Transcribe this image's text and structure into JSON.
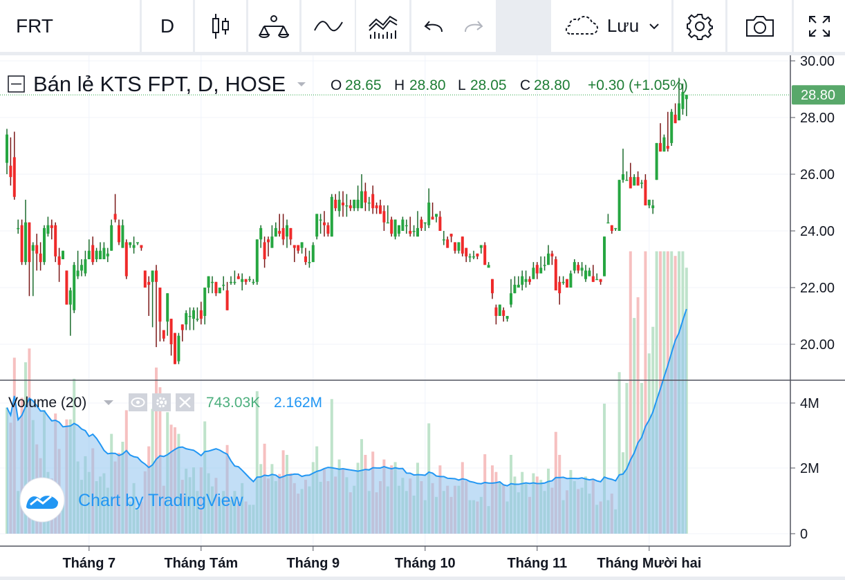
{
  "toolbar": {
    "symbol": "FRT",
    "interval": "D",
    "save_label": "Lưu",
    "icons": [
      "candles-icon",
      "indicators-icon",
      "compare-icon",
      "templates-icon",
      "undo-icon",
      "redo-icon",
      "cloud-icon",
      "chevron-down-icon",
      "gear-icon",
      "camera-icon",
      "fullscreen-icon"
    ]
  },
  "legend": {
    "title": "Bán lẻ KTS FPT, D, HOSE",
    "o_label": "O",
    "o_value": "28.65",
    "h_label": "H",
    "h_value": "28.80",
    "l_label": "L",
    "l_value": "28.05",
    "c_label": "C",
    "c_value": "28.80",
    "change": "+0.30 (+1.05%)",
    "last_price_tag": "28.80"
  },
  "volume_legend": {
    "title": "Volume (20)",
    "value": "743.03K",
    "ma_value": "2.162M"
  },
  "watermark": "Chart by TradingView",
  "colors": {
    "up": "#26a641",
    "down": "#ef2a2a",
    "wick_up": "#1a6b2c",
    "wick_down": "#7a1616",
    "vol_up": "#bfe3cb",
    "vol_down": "#f6c0c0",
    "vol_ma_fill": "#8fc3ee",
    "vol_ma_line": "#2196f3",
    "tag": "#58a86a"
  },
  "chart_data": {
    "type": "candlestick",
    "price_axis": {
      "ticks": [
        "30.00",
        "28.00",
        "26.00",
        "24.00",
        "22.00",
        "20.00"
      ],
      "range": [
        18.8,
        30.1
      ]
    },
    "volume_axis": {
      "ticks": [
        "4M",
        "2M",
        "0"
      ],
      "range": [
        0,
        4400000
      ]
    },
    "time_axis": [
      "Tháng 7",
      "Tháng Tám",
      "Tháng 9",
      "Tháng 10",
      "Tháng 11",
      "Tháng Mười hai"
    ],
    "month_index": [
      22,
      52,
      82,
      112,
      142,
      172
    ],
    "candles": [
      [
        26.4,
        27.4,
        27.6,
        26.0
      ],
      [
        26.3,
        25.9,
        27.3,
        25.6
      ],
      [
        26.6,
        25.2,
        27.5,
        25.1
      ],
      [
        24.1,
        24.1,
        24.4,
        23.9
      ],
      [
        24.2,
        22.9,
        24.4,
        22.8
      ],
      [
        22.9,
        24.3,
        25.1,
        22.8
      ],
      [
        24.3,
        22.9,
        24.3,
        21.7
      ],
      [
        23.3,
        23.5,
        23.6,
        21.7
      ],
      [
        23.5,
        23.2,
        23.9,
        22.6
      ],
      [
        23.2,
        22.9,
        23.6,
        22.6
      ],
      [
        22.9,
        24.1,
        24.2,
        22.8
      ],
      [
        23.9,
        24.2,
        24.5,
        23.8
      ],
      [
        24.2,
        24.1,
        24.4,
        23.7
      ],
      [
        24.2,
        23.1,
        24.3,
        22.9
      ],
      [
        23.1,
        22.8,
        23.4,
        22.2
      ],
      [
        23.0,
        23.3,
        23.3,
        23.1
      ],
      [
        22.6,
        21.4,
        22.6,
        21.4
      ],
      [
        21.4,
        21.9,
        22.0,
        20.3
      ],
      [
        21.2,
        22.8,
        22.9,
        21.1
      ],
      [
        22.4,
        22.6,
        23.3,
        22.3
      ],
      [
        22.6,
        22.8,
        23.0,
        22.4
      ],
      [
        22.5,
        23.0,
        23.3,
        22.4
      ],
      [
        23.0,
        23.3,
        23.7,
        23.0
      ],
      [
        23.5,
        22.9,
        23.8,
        22.8
      ],
      [
        23.0,
        23.3,
        23.4,
        22.9
      ],
      [
        23.0,
        23.3,
        23.6,
        23.0
      ],
      [
        23.0,
        23.4,
        23.6,
        23.0
      ],
      [
        23.1,
        23.2,
        23.4,
        22.9
      ],
      [
        23.3,
        24.2,
        24.4,
        23.3
      ],
      [
        24.6,
        24.4,
        25.3,
        24.3
      ],
      [
        24.2,
        23.6,
        24.4,
        23.5
      ],
      [
        23.4,
        24.2,
        24.4,
        23.4
      ],
      [
        23.6,
        22.4,
        23.7,
        22.3
      ],
      [
        23.5,
        23.6,
        23.6,
        23.4
      ],
      [
        23.4,
        23.5,
        23.8,
        23.2
      ],
      [
        23.6,
        23.6,
        23.6,
        23.5
      ],
      [
        23.5,
        23.4,
        23.5,
        23.3
      ],
      [
        22.6,
        22.0,
        22.6,
        22.1
      ],
      [
        22.2,
        22.1,
        22.4,
        21.0
      ],
      [
        22.2,
        22.6,
        22.6,
        20.6
      ],
      [
        22.6,
        22.2,
        22.8,
        19.9
      ],
      [
        22.0,
        20.8,
        22.0,
        20.1
      ],
      [
        20.5,
        20.2,
        20.5,
        20.1
      ],
      [
        20.8,
        21.8,
        21.8,
        20.3
      ],
      [
        20.9,
        20.0,
        20.9,
        19.6
      ],
      [
        20.4,
        19.3,
        20.4,
        19.3
      ],
      [
        19.4,
        20.3,
        20.4,
        19.3
      ],
      [
        20.7,
        20.5,
        20.7,
        20.1
      ],
      [
        20.7,
        21.1,
        21.2,
        20.5
      ],
      [
        21.0,
        21.0,
        21.3,
        20.5
      ],
      [
        20.9,
        21.2,
        21.3,
        20.5
      ],
      [
        20.9,
        20.9,
        21.3,
        20.8
      ],
      [
        21.2,
        20.9,
        21.5,
        20.7
      ],
      [
        21.0,
        22.0,
        22.0,
        20.7
      ],
      [
        22.0,
        22.4,
        22.4,
        21.8
      ],
      [
        22.2,
        22.2,
        22.4,
        21.8
      ],
      [
        22.2,
        21.8,
        22.2,
        21.7
      ],
      [
        21.8,
        22.0,
        22.0,
        21.8
      ],
      [
        22.1,
        22.1,
        22.4,
        21.9
      ],
      [
        21.9,
        21.2,
        22.2,
        21.2
      ],
      [
        22.2,
        22.2,
        22.4,
        22.1
      ],
      [
        22.2,
        22.2,
        22.6,
        22.1
      ],
      [
        22.4,
        22.3,
        22.5,
        22.3
      ],
      [
        22.2,
        22.3,
        22.5,
        21.9
      ],
      [
        22.3,
        22.2,
        22.3,
        22.1
      ],
      [
        22.3,
        22.3,
        22.4,
        22.2
      ],
      [
        22.2,
        22.2,
        22.3,
        22.1
      ],
      [
        22.2,
        23.7,
        23.7,
        22.1
      ],
      [
        23.7,
        24.1,
        24.2,
        23.4
      ],
      [
        23.6,
        23.0,
        23.8,
        22.7
      ],
      [
        23.7,
        23.6,
        23.8,
        23.1
      ],
      [
        23.4,
        23.8,
        24.2,
        23.4
      ],
      [
        23.8,
        24.1,
        24.3,
        23.8
      ],
      [
        24.0,
        23.9,
        24.6,
        23.8
      ],
      [
        24.1,
        23.7,
        24.6,
        23.5
      ],
      [
        23.8,
        24.2,
        24.4,
        23.4
      ],
      [
        24.1,
        23.7,
        24.1,
        23.5
      ],
      [
        23.5,
        23.4,
        23.5,
        22.9
      ],
      [
        23.5,
        23.3,
        23.5,
        23.2
      ],
      [
        23.4,
        23.6,
        23.6,
        23.2
      ],
      [
        23.1,
        22.9,
        23.4,
        22.8
      ],
      [
        22.9,
        22.9,
        23.3,
        22.7
      ],
      [
        22.9,
        23.5,
        23.6,
        22.9
      ],
      [
        23.8,
        24.6,
        24.6,
        23.7
      ],
      [
        24.4,
        24.4,
        24.6,
        23.9
      ],
      [
        24.3,
        24.2,
        24.7,
        23.8
      ],
      [
        24.2,
        23.9,
        24.3,
        23.8
      ],
      [
        23.8,
        25.2,
        25.3,
        23.8
      ],
      [
        25.1,
        24.8,
        25.3,
        24.7
      ],
      [
        24.7,
        25.1,
        25.4,
        24.5
      ],
      [
        25.0,
        24.9,
        25.4,
        24.5
      ],
      [
        24.9,
        24.9,
        25.3,
        24.5
      ],
      [
        24.9,
        24.8,
        25.1,
        24.7
      ],
      [
        24.8,
        25.1,
        25.1,
        24.7
      ],
      [
        24.8,
        25.1,
        25.6,
        24.7
      ],
      [
        24.8,
        25.4,
        26.0,
        24.8
      ],
      [
        25.4,
        25.0,
        25.7,
        24.7
      ],
      [
        25.0,
        25.0,
        25.2,
        24.7
      ],
      [
        25.3,
        24.8,
        25.6,
        24.6
      ],
      [
        24.9,
        24.8,
        25.0,
        24.6
      ],
      [
        24.9,
        24.6,
        25.1,
        24.6
      ],
      [
        24.7,
        24.3,
        24.9,
        24.0
      ],
      [
        24.3,
        24.3,
        24.9,
        24.3
      ],
      [
        24.4,
        23.9,
        24.5,
        23.8
      ],
      [
        23.8,
        24.4,
        24.4,
        23.7
      ],
      [
        23.9,
        24.2,
        24.2,
        23.8
      ],
      [
        24.0,
        24.4,
        24.5,
        24.0
      ],
      [
        24.2,
        24.2,
        24.4,
        23.9
      ],
      [
        24.0,
        23.9,
        24.5,
        23.8
      ],
      [
        24.0,
        24.0,
        24.2,
        23.8
      ],
      [
        23.8,
        24.1,
        24.7,
        23.8
      ],
      [
        24.4,
        24.1,
        24.5,
        24.0
      ],
      [
        24.3,
        24.3,
        24.3,
        24.0
      ],
      [
        24.2,
        25.0,
        25.5,
        24.1
      ],
      [
        24.5,
        24.4,
        25.0,
        24.4
      ],
      [
        24.5,
        24.6,
        24.6,
        24.3
      ],
      [
        24.5,
        24.0,
        24.7,
        24.0
      ],
      [
        23.7,
        23.7,
        24.0,
        23.5
      ],
      [
        23.7,
        23.4,
        23.8,
        23.4
      ],
      [
        23.9,
        23.8,
        23.9,
        23.6
      ],
      [
        23.6,
        23.3,
        23.6,
        23.2
      ],
      [
        23.3,
        23.6,
        23.6,
        23.2
      ],
      [
        23.8,
        23.2,
        23.8,
        23.1
      ],
      [
        23.4,
        23.1,
        23.4,
        22.9
      ],
      [
        23.1,
        23.1,
        23.2,
        22.9
      ],
      [
        23.1,
        23.1,
        23.3,
        23.0
      ],
      [
        23.2,
        23.1,
        23.2,
        23.0
      ],
      [
        23.4,
        23.5,
        23.5,
        23.2
      ],
      [
        23.5,
        22.8,
        23.6,
        22.8
      ],
      [
        22.7,
        22.8,
        22.9,
        22.8
      ],
      [
        22.3,
        21.8,
        22.3,
        21.6
      ],
      [
        21.3,
        21.0,
        21.4,
        20.7
      ],
      [
        21.0,
        21.4,
        21.4,
        21.0
      ],
      [
        21.2,
        21.0,
        21.3,
        20.8
      ],
      [
        20.9,
        21.0,
        21.0,
        20.8
      ],
      [
        21.4,
        21.8,
        22.3,
        21.3
      ],
      [
        21.8,
        22.1,
        22.4,
        21.8
      ],
      [
        22.0,
        22.1,
        22.4,
        22.0
      ],
      [
        22.1,
        22.4,
        22.6,
        21.9
      ],
      [
        22.2,
        22.3,
        22.6,
        22.0
      ],
      [
        22.3,
        22.2,
        22.4,
        22.1
      ],
      [
        22.3,
        22.7,
        22.9,
        22.3
      ],
      [
        22.8,
        22.5,
        22.9,
        22.3
      ],
      [
        22.5,
        22.7,
        23.1,
        22.5
      ],
      [
        22.8,
        22.8,
        23.1,
        22.6
      ],
      [
        22.8,
        23.2,
        23.5,
        22.8
      ],
      [
        23.2,
        23.1,
        23.3,
        22.8
      ],
      [
        23.0,
        21.9,
        23.1,
        22.1
      ],
      [
        22.2,
        21.8,
        22.4,
        21.4
      ],
      [
        22.2,
        22.2,
        22.4,
        22.1
      ],
      [
        22.3,
        22.0,
        22.3,
        22.0
      ],
      [
        22.0,
        22.5,
        22.6,
        22.0
      ],
      [
        22.6,
        22.9,
        23.0,
        22.5
      ],
      [
        22.8,
        22.6,
        22.9,
        22.5
      ],
      [
        22.6,
        22.7,
        22.9,
        22.4
      ],
      [
        22.3,
        22.6,
        22.8,
        22.2
      ],
      [
        22.4,
        22.6,
        22.7,
        22.4
      ],
      [
        22.4,
        22.2,
        22.8,
        22.2
      ],
      [
        22.3,
        22.3,
        22.5,
        22.3
      ],
      [
        22.3,
        22.2,
        22.3,
        22.1
      ],
      [
        22.4,
        23.8,
        23.8,
        22.4
      ],
      [
        24.3,
        24.3,
        24.6,
        24.3
      ],
      [
        24.2,
        24.0,
        24.2,
        23.9
      ],
      [
        24.1,
        24.1,
        24.1,
        24.0
      ],
      [
        24.0,
        25.8,
        25.8,
        24.0
      ],
      [
        25.8,
        26.0,
        26.9,
        25.7
      ],
      [
        25.8,
        25.8,
        26.1,
        25.8
      ],
      [
        25.9,
        25.5,
        26.4,
        25.5
      ],
      [
        25.6,
        25.9,
        26.0,
        25.6
      ],
      [
        25.9,
        25.6,
        26.1,
        25.6
      ],
      [
        25.7,
        25.7,
        25.8,
        25.5
      ],
      [
        25.8,
        24.9,
        26.0,
        24.9
      ],
      [
        24.9,
        25.1,
        25.1,
        24.8
      ],
      [
        24.8,
        24.9,
        25.1,
        24.6
      ],
      [
        25.8,
        27.1,
        27.1,
        25.8
      ],
      [
        27.1,
        26.8,
        27.8,
        26.8
      ],
      [
        26.8,
        27.3,
        27.4,
        26.8
      ],
      [
        27.0,
        26.9,
        28.2,
        26.8
      ],
      [
        27.1,
        28.2,
        28.3,
        27.0
      ],
      [
        28.1,
        27.8,
        28.5,
        27.8
      ],
      [
        27.9,
        28.5,
        29.4,
        27.9
      ],
      [
        28.3,
        28.9,
        29.2,
        28.1
      ],
      [
        28.65,
        28.8,
        28.8,
        28.05
      ]
    ]
  }
}
